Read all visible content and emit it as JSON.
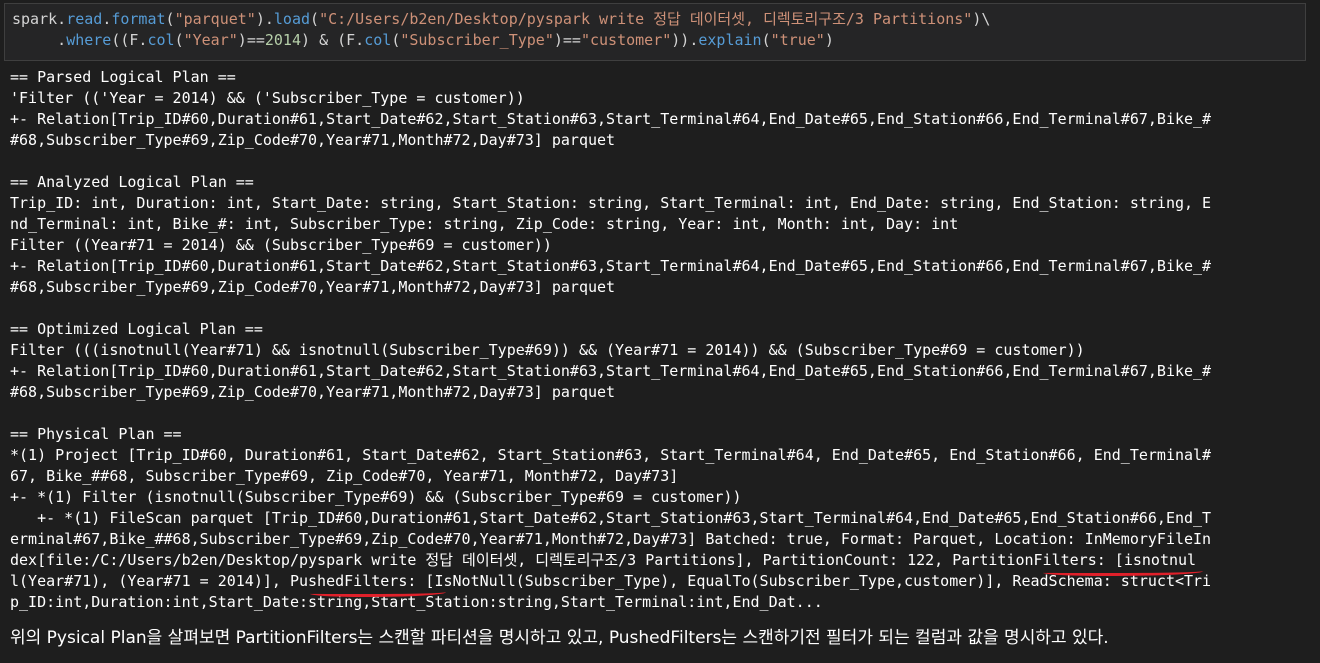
{
  "code_cell": {
    "line1": {
      "t1": "spark",
      "t2": ".",
      "t3": "read",
      "t4": ".",
      "t5": "format",
      "t6": "(",
      "t7": "\"parquet\"",
      "t8": ").",
      "t9": "load",
      "t10": "(",
      "t11": "\"C:/Users/b2en/Desktop/pyspark write 정답 데이터셋, 디렉토리구조/3 Partitions\"",
      "t12": ")\\"
    },
    "line2": {
      "t1": "     .",
      "t2": "where",
      "t3": "((F.",
      "t4": "col",
      "t5": "(",
      "t6": "\"Year\"",
      "t7": ")",
      "t8": "==",
      "t9": "2014",
      "t10": ") ",
      "t11": "&",
      "t12": " (F.",
      "t13": "col",
      "t14": "(",
      "t15": "\"Subscriber_Type\"",
      "t16": ")",
      "t17": "==",
      "t18": "\"customer\"",
      "t19": ")).",
      "t20": "explain",
      "t21": "(",
      "t22": "\"true\"",
      "t23": ")"
    }
  },
  "output_lines": [
    "== Parsed Logical Plan ==",
    "'Filter (('Year = 2014) && ('Subscriber_Type = customer))",
    "+- Relation[Trip_ID#60,Duration#61,Start_Date#62,Start_Station#63,Start_Terminal#64,End_Date#65,End_Station#66,End_Terminal#67,Bike_#",
    "#68,Subscriber_Type#69,Zip_Code#70,Year#71,Month#72,Day#73] parquet",
    "",
    "== Analyzed Logical Plan ==",
    "Trip_ID: int, Duration: int, Start_Date: string, Start_Station: string, Start_Terminal: int, End_Date: string, End_Station: string, E",
    "nd_Terminal: int, Bike_#: int, Subscriber_Type: string, Zip_Code: string, Year: int, Month: int, Day: int",
    "Filter ((Year#71 = 2014) && (Subscriber_Type#69 = customer))",
    "+- Relation[Trip_ID#60,Duration#61,Start_Date#62,Start_Station#63,Start_Terminal#64,End_Date#65,End_Station#66,End_Terminal#67,Bike_#",
    "#68,Subscriber_Type#69,Zip_Code#70,Year#71,Month#72,Day#73] parquet",
    "",
    "== Optimized Logical Plan ==",
    "Filter (((isnotnull(Year#71) && isnotnull(Subscriber_Type#69)) && (Year#71 = 2014)) && (Subscriber_Type#69 = customer))",
    "+- Relation[Trip_ID#60,Duration#61,Start_Date#62,Start_Station#63,Start_Terminal#64,End_Date#65,End_Station#66,End_Terminal#67,Bike_#",
    "#68,Subscriber_Type#69,Zip_Code#70,Year#71,Month#72,Day#73] parquet",
    "",
    "== Physical Plan ==",
    "*(1) Project [Trip_ID#60, Duration#61, Start_Date#62, Start_Station#63, Start_Terminal#64, End_Date#65, End_Station#66, End_Terminal#",
    "67, Bike_##68, Subscriber_Type#69, Zip_Code#70, Year#71, Month#72, Day#73]",
    "+- *(1) Filter (isnotnull(Subscriber_Type#69) && (Subscriber_Type#69 = customer))",
    "   +- *(1) FileScan parquet [Trip_ID#60,Duration#61,Start_Date#62,Start_Station#63,Start_Terminal#64,End_Date#65,End_Station#66,End_T",
    "erminal#67,Bike_##68,Subscriber_Type#69,Zip_Code#70,Year#71,Month#72,Day#73] Batched: true, Format: Parquet, Location: InMemoryFileIn",
    "dex[file:/C:/Users/b2en/Desktop/pyspark write 정답 데이터셋, 디렉토리구조/3 Partitions], PartitionCount: 122, PartitionFilters: [isnotnul",
    "l(Year#71), (Year#71 = 2014)], PushedFilters: [IsNotNull(Subscriber_Type), EqualTo(Subscriber_Type,customer)], ReadSchema: struct<Tri",
    "p_ID:int,Duration:int,Start_Date:string,Start_Station:string,Start_Terminal:int,End_Dat..."
  ],
  "caption": "위의 Pysical Plan을 살펴보면 PartitionFilters는 스캔할 파티션을 명시하고 있고, PushedFilters는 스캔하기전 필터가 되는 컬럼과 값을 명시하고 있다.",
  "colors": {
    "background": "#1e1e1e",
    "code_cell_bg": "#252526",
    "string": "#ce9178",
    "function": "#dcdcaa",
    "number": "#b5cea8",
    "keyword": "#569cd6",
    "underline_marker": "#e0202a"
  }
}
